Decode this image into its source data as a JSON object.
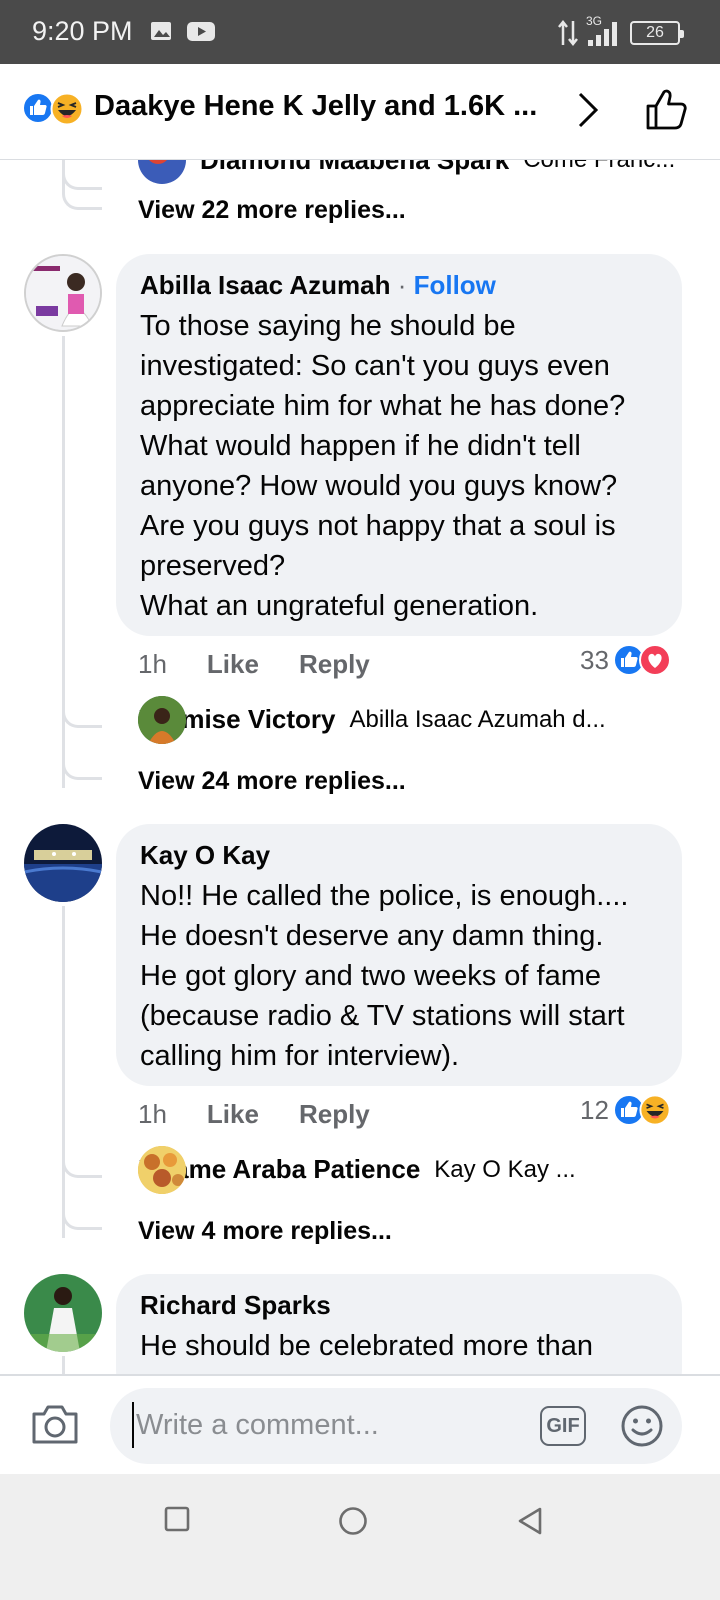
{
  "status": {
    "time": "9:20 PM",
    "network": "3G",
    "battery": "26"
  },
  "header": {
    "title": "Daakye Hene K Jelly and 1.6K ..."
  },
  "top_thread": {
    "reply_preview": {
      "name": "Diamond Maabena Spark",
      "snippet": "Come Franc..."
    },
    "view_more": "View 22 more replies..."
  },
  "comments": [
    {
      "author": "Abilla Isaac Azumah",
      "separator": "·",
      "follow": "Follow",
      "text": "To those saying he should be investigated: So can't you guys even appreciate him for what he has done? What would happen if he didn't tell anyone? How would you guys know? Are you guys not happy that a soul is preserved?\nWhat an ungrateful generation.",
      "time": "1h",
      "like": "Like",
      "reply": "Reply",
      "reaction_count": "33",
      "reactions": [
        "like",
        "love"
      ],
      "reply_preview": {
        "name": "Promise Victory",
        "snippet": "Abilla Isaac Azumah d..."
      },
      "view_more": "View 24 more replies..."
    },
    {
      "author": "Kay O Kay",
      "text": "No!! He called the police, is enough....\nHe doesn't deserve any damn thing.\nHe got glory and two weeks of fame (because radio & TV stations will start calling him for interview).",
      "time": "1h",
      "like": "Like",
      "reply": "Reply",
      "reaction_count": "12",
      "reactions": [
        "like",
        "haha"
      ],
      "reply_preview": {
        "name": "Maame Araba Patience",
        "snippet": "Kay O Kay ..."
      },
      "view_more": "View 4 more replies..."
    },
    {
      "author": "Richard Sparks",
      "text": "He should be celebrated more than"
    }
  ],
  "composer": {
    "placeholder": "Write a comment...",
    "gif": "GIF"
  },
  "colors": {
    "accent": "#1877f2",
    "bubble": "#f0f2f5",
    "muted": "#65676b",
    "love": "#f33e58",
    "haha": "#f7b125"
  }
}
